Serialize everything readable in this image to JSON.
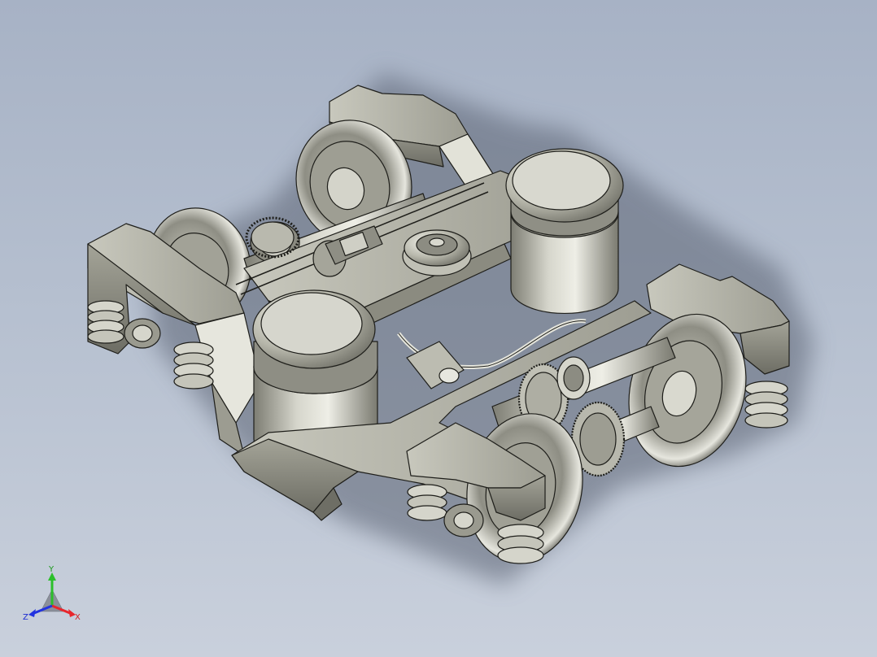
{
  "viewport": {
    "background_top": "#a7b2c5",
    "background_bottom": "#c9d0dc",
    "model": "bogie-assembly"
  },
  "model_colors": {
    "body_light": "#d9d9cf",
    "body_mid": "#b3b3a6",
    "body_dark": "#6f6f66",
    "edge": "#1e1e1a",
    "shadow": "#5a6272"
  },
  "triad": {
    "x_label": "X",
    "y_label": "Y",
    "z_label": "Z",
    "x_color": "#e8262c",
    "y_color": "#2bbf2b",
    "z_color": "#2233e0"
  }
}
